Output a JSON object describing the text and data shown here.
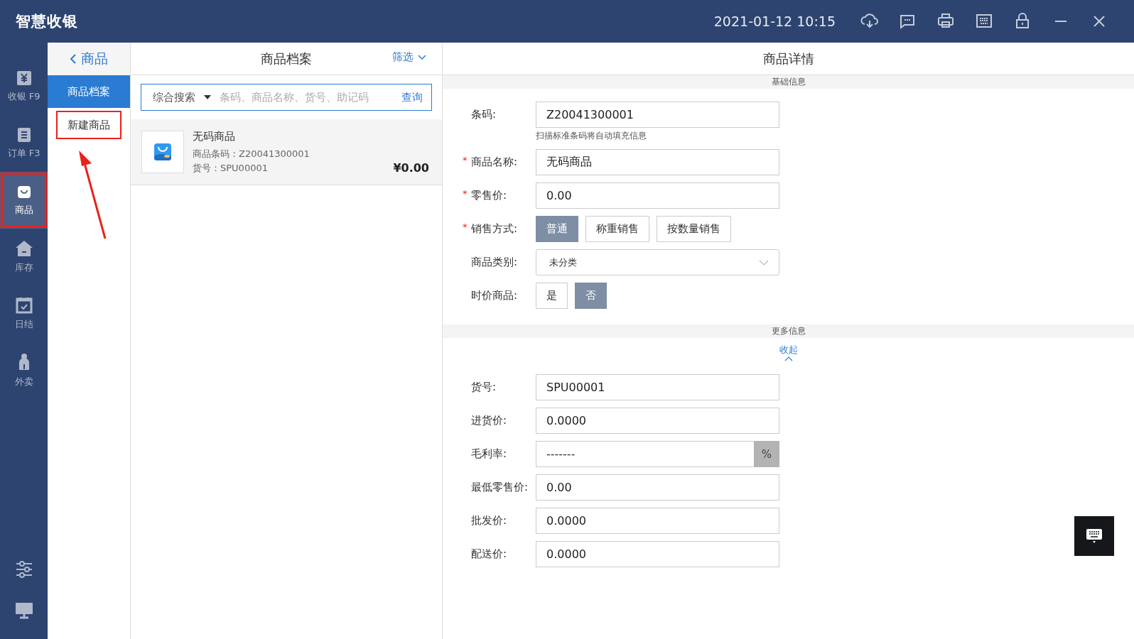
{
  "app": {
    "title": "智慧收银",
    "datetime": "2021-01-12 10:15"
  },
  "rail": [
    {
      "label": "收银 F9",
      "selected": false,
      "highlighted": false
    },
    {
      "label": "订单 F3",
      "selected": false,
      "highlighted": false
    },
    {
      "label": "商品",
      "selected": true,
      "highlighted": true
    },
    {
      "label": "库存",
      "selected": false,
      "highlighted": false
    },
    {
      "label": "日结",
      "selected": false,
      "highlighted": false
    },
    {
      "label": "外卖",
      "selected": false,
      "highlighted": false
    }
  ],
  "submenu": {
    "back": "商品",
    "items": [
      {
        "label": "商品档案",
        "selected": true,
        "highlighted": false
      },
      {
        "label": "新建商品",
        "selected": false,
        "highlighted": true
      }
    ]
  },
  "list": {
    "title": "商品档案",
    "filter": "筛选",
    "search_type": "综合搜索",
    "search_placeholder": "条码、商品名称、货号、助记码",
    "search_button": "查询",
    "items": [
      {
        "name": "无码商品",
        "barcode": "商品条码：Z20041300001",
        "sku": "货号：SPU00001",
        "price": "¥0.00",
        "selected": true
      }
    ]
  },
  "detail": {
    "title": "商品详情",
    "sections": [
      {
        "title": "基础信息",
        "fields": [
          {
            "kind": "text",
            "label": "条码:",
            "value": "Z20041300001",
            "hint": "扫描标准条码将自动填充信息"
          },
          {
            "kind": "text",
            "label": "商品名称:",
            "required_mark": "*",
            "value": "无码商品"
          },
          {
            "kind": "text",
            "label": "零售价:",
            "required_mark": "*",
            "value": "0.00"
          },
          {
            "kind": "choice",
            "label": "销售方式:",
            "required_mark": "*",
            "options": [
              {
                "label": "普通",
                "selected": true
              },
              {
                "label": "称重销售",
                "selected": false
              },
              {
                "label": "按数量销售",
                "selected": false
              }
            ]
          },
          {
            "kind": "select",
            "label": "商品类别:",
            "value": "未分类"
          },
          {
            "kind": "choice",
            "label": "时价商品:",
            "options": [
              {
                "label": "是",
                "selected": false
              },
              {
                "label": "否",
                "selected": true
              }
            ]
          }
        ]
      },
      {
        "title": "更多信息",
        "toggle": "收起",
        "fields": [
          {
            "kind": "text",
            "label": "货号:",
            "value": "SPU00001"
          },
          {
            "kind": "text",
            "label": "进货价:",
            "value": "0.0000"
          },
          {
            "kind": "percent",
            "label": "毛利率:",
            "value": "-------",
            "unit": "%"
          },
          {
            "kind": "text",
            "label": "最低零售价:",
            "value": "0.00"
          },
          {
            "kind": "text",
            "label": "批发价:",
            "value": "0.0000"
          },
          {
            "kind": "text",
            "label": "配送价:",
            "value": "0.0000"
          }
        ]
      }
    ]
  }
}
